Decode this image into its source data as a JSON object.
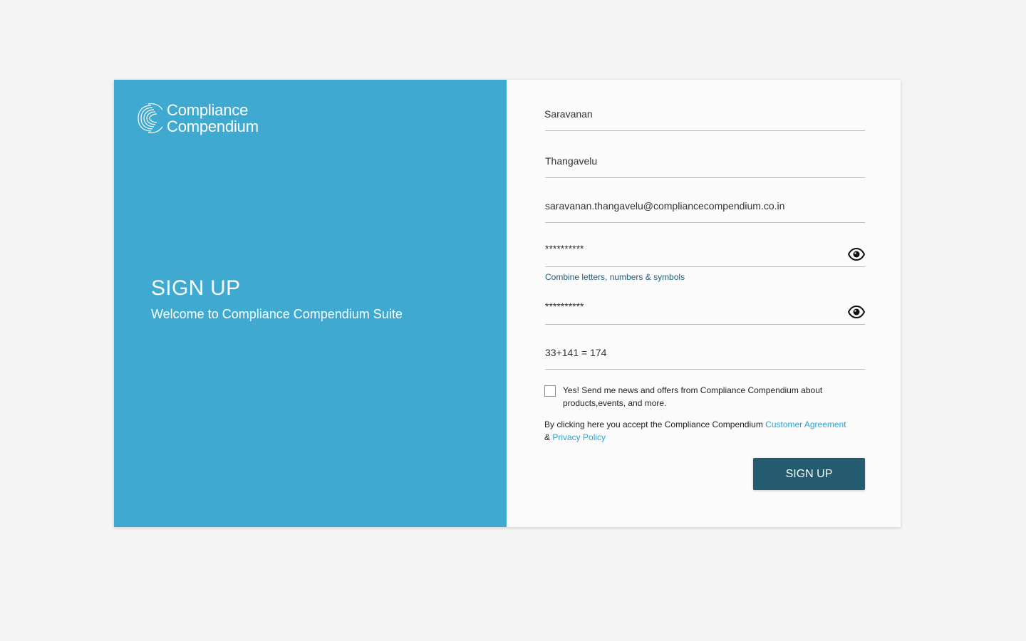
{
  "brand": {
    "name_line1": "Compliance",
    "name_line2": "Compendium",
    "logo_icon": "compendium-wave-icon"
  },
  "hero": {
    "title": "SIGN UP",
    "subtitle": "Welcome to Compliance Compendium Suite"
  },
  "form": {
    "first_name": "Saravanan",
    "last_name": "Thangavelu",
    "email": "saravanan.thangavelu@compliancecompendium.co.in",
    "password": "**********",
    "password_hint": "Combine letters, numbers & symbols",
    "confirm_password": "**********",
    "captcha": "33+141 = 174",
    "newsletter_label": "Yes! Send me news and offers from Compliance Compendium about products,events, and more.",
    "terms_prefix": "By clicking here you accept the Compliance Compendium ",
    "customer_agreement": "Customer Agreement",
    "terms_join": "& ",
    "privacy_policy": "Privacy Policy",
    "submit_label": "SIGN UP",
    "visibility_icon": "eye-icon"
  },
  "colors": {
    "panel": "#40a9d0",
    "button": "#245b6e",
    "link": "#2fa1cf",
    "hint": "#1f5d74"
  }
}
